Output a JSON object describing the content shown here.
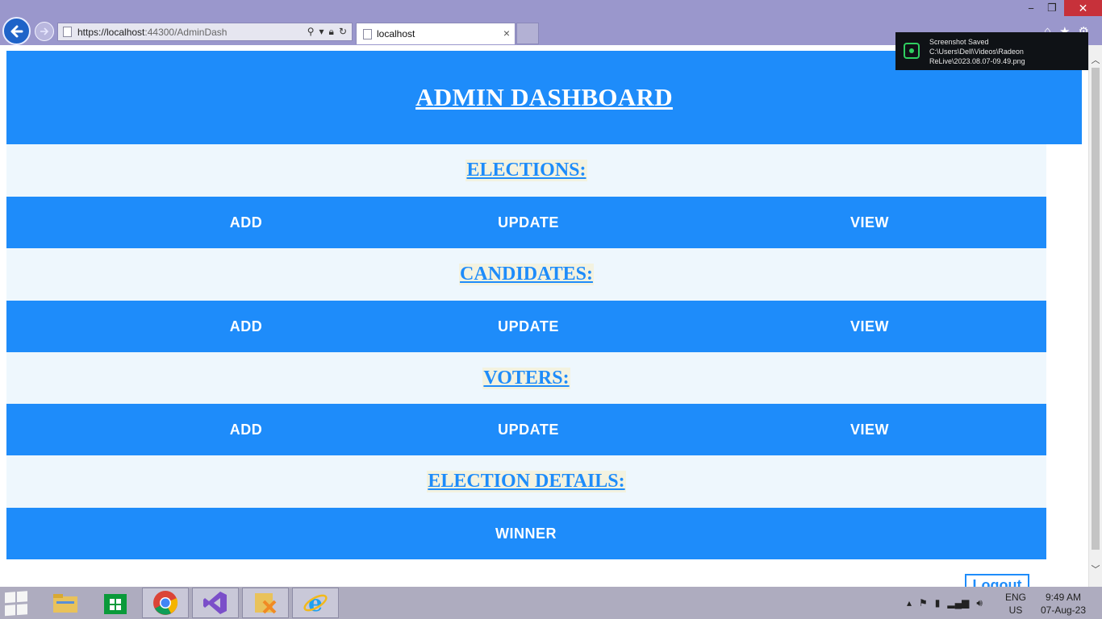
{
  "browser": {
    "url_host": "https://localhost",
    "url_port_path": ":44300/AdminDash",
    "tab_title": "localhost",
    "tab_close": "×",
    "window_controls": {
      "minimize": "−",
      "maximize": "❐",
      "close": "✕"
    }
  },
  "notification": {
    "title": "Screenshot Saved",
    "path_line1": "C:\\Users\\Dell\\Videos\\Radeon",
    "path_line2": "ReLive\\2023.08.07-09.49.png"
  },
  "page": {
    "title": "ADMIN DASHBOARD",
    "sections": [
      {
        "heading": "ELECTIONS:",
        "buttons": [
          "ADD",
          "UPDATE",
          "VIEW"
        ]
      },
      {
        "heading": "CANDIDATES:",
        "buttons": [
          "ADD",
          "UPDATE",
          "VIEW"
        ]
      },
      {
        "heading": "VOTERS:",
        "buttons": [
          "ADD",
          "UPDATE",
          "VIEW"
        ]
      },
      {
        "heading": "ELECTION DETAILS:",
        "buttons": [
          "WINNER"
        ]
      }
    ],
    "logout_label": "Logout"
  },
  "taskbar": {
    "apps": [
      "file-explorer",
      "windows-store",
      "chrome",
      "visual-studio",
      "xampp",
      "internet-explorer"
    ],
    "active_app": "internet-explorer",
    "language": "ENG",
    "region": "US",
    "time": "9:49 AM",
    "date": "07-Aug-23"
  },
  "colors": {
    "brand": "#1e8cfa",
    "section_bg": "#eef7fd",
    "chrome_bg": "#9a97cc"
  }
}
